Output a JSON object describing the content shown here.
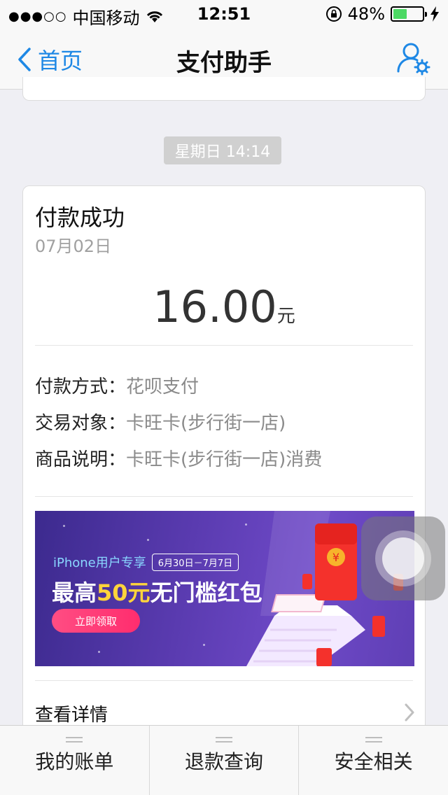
{
  "status_bar": {
    "signal": "●●●○○",
    "carrier": "中国移动",
    "time": "12:51",
    "battery_text": "48%",
    "battery_level": 0.48,
    "battery_color": "#4cd964"
  },
  "nav": {
    "back_label": "首页",
    "title": "支付助手",
    "settings_icon": "user-settings-icon",
    "accent": "#1e88e5"
  },
  "timestamp": "星期日 14:14",
  "card": {
    "title": "付款成功",
    "date": "07月02日",
    "amount": "16.00",
    "currency_unit": "元",
    "rows": [
      {
        "label": "付款方式：",
        "value": "花呗支付"
      },
      {
        "label": "交易对象：",
        "value": "卡旺卡(步行街一店)"
      },
      {
        "label": "商品说明：",
        "value": "卡旺卡(步行街一店)消费"
      }
    ],
    "banner": {
      "tag": "iPhone用户专享",
      "dates": "6月30日－7月7日",
      "headline_pre": "最高",
      "headline_highlight": "50元",
      "headline_post": "无门槛红包",
      "cta": "立即领取"
    },
    "detail_label": "查看详情"
  },
  "tabbar": {
    "tabs": [
      "我的账单",
      "退款查询",
      "安全相关"
    ]
  }
}
